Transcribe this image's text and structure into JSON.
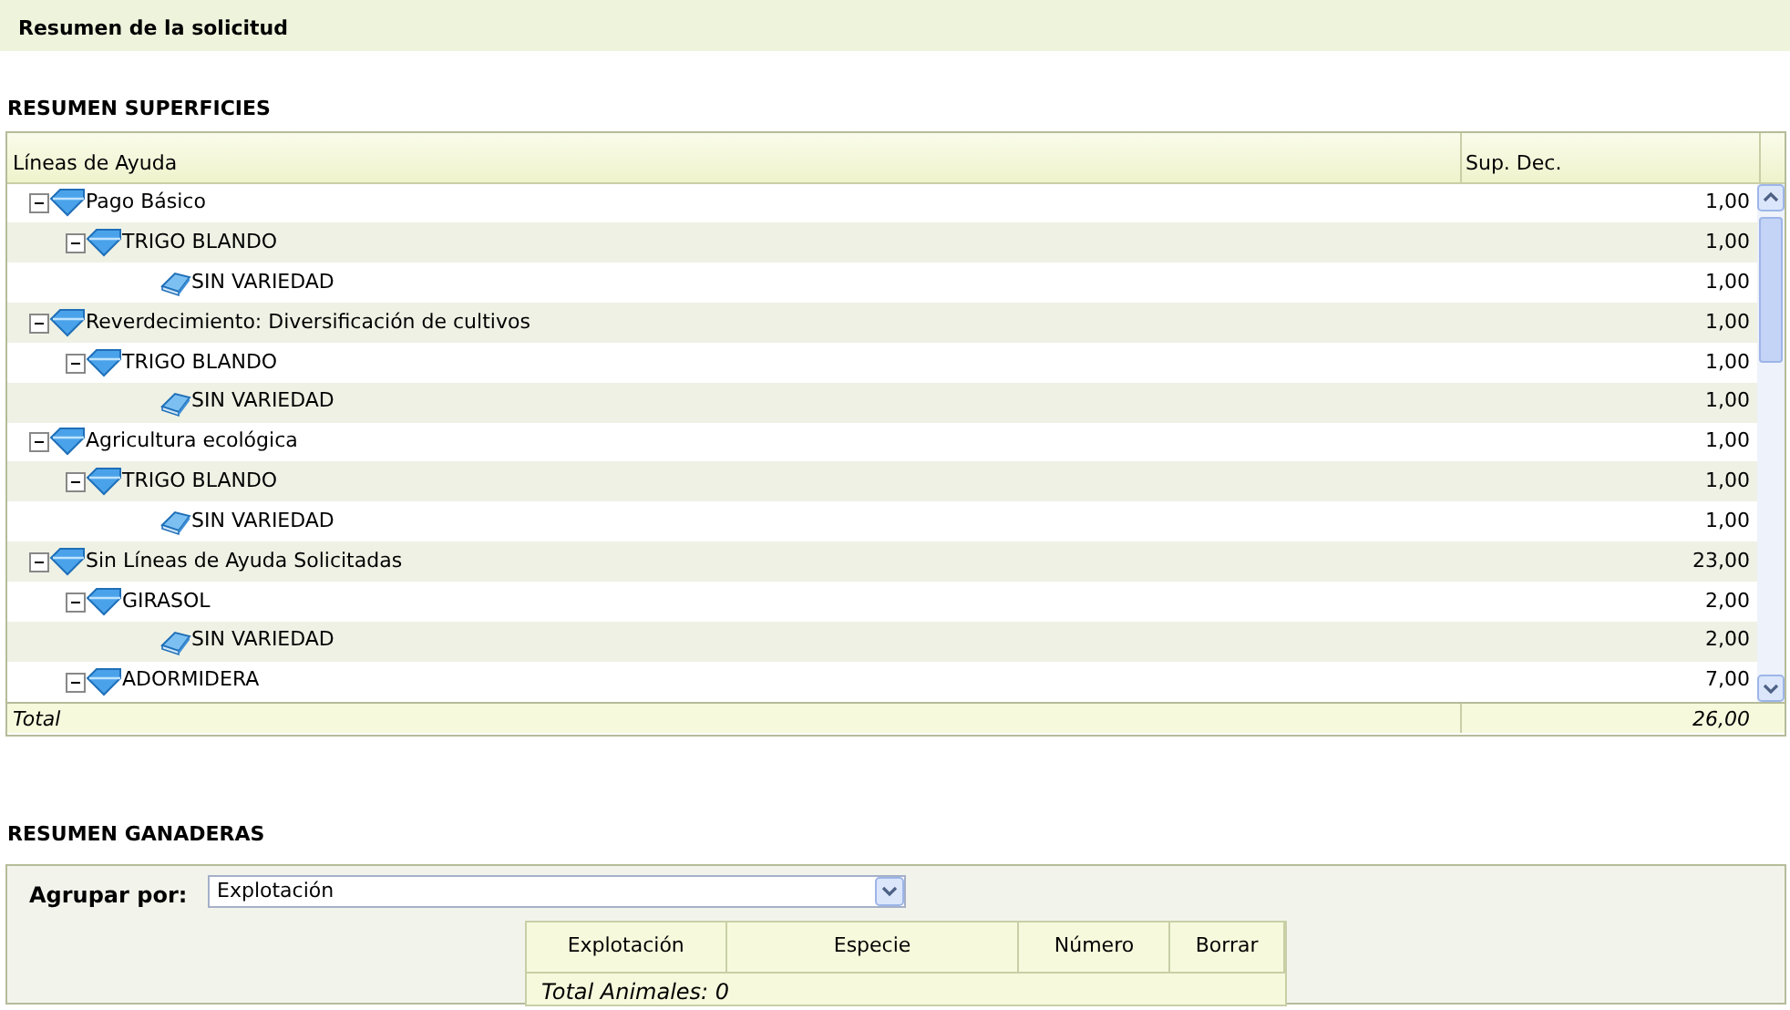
{
  "page_title": "Resumen de la solicitud",
  "superficies": {
    "heading": "RESUMEN SUPERFICIES",
    "columns": [
      "Líneas de Ayuda",
      "Sup. Dec."
    ],
    "tree": [
      {
        "label": "Pago Básico",
        "value": "1,00",
        "kind": "group",
        "expanded": true,
        "children": [
          {
            "label": "TRIGO BLANDO",
            "value": "1,00",
            "kind": "group",
            "expanded": true,
            "children": [
              {
                "label": "SIN VARIEDAD",
                "value": "1,00",
                "kind": "leaf"
              }
            ]
          }
        ]
      },
      {
        "label": "Reverdecimiento: Diversificación de cultivos",
        "value": "1,00",
        "kind": "group",
        "expanded": true,
        "children": [
          {
            "label": "TRIGO BLANDO",
            "value": "1,00",
            "kind": "group",
            "expanded": true,
            "children": [
              {
                "label": "SIN VARIEDAD",
                "value": "1,00",
                "kind": "leaf"
              }
            ]
          }
        ]
      },
      {
        "label": "Agricultura ecológica",
        "value": "1,00",
        "kind": "group",
        "expanded": true,
        "children": [
          {
            "label": "TRIGO BLANDO",
            "value": "1,00",
            "kind": "group",
            "expanded": true,
            "children": [
              {
                "label": "SIN VARIEDAD",
                "value": "1,00",
                "kind": "leaf"
              }
            ]
          }
        ]
      },
      {
        "label": "Sin Líneas de Ayuda Solicitadas",
        "value": "23,00",
        "kind": "group",
        "expanded": true,
        "children": [
          {
            "label": "GIRASOL",
            "value": "2,00",
            "kind": "group",
            "expanded": true,
            "children": [
              {
                "label": "SIN VARIEDAD",
                "value": "2,00",
                "kind": "leaf"
              }
            ]
          },
          {
            "label": "ADORMIDERA",
            "value": "7,00",
            "kind": "group",
            "expanded": true
          }
        ]
      }
    ],
    "total": {
      "label": "Total",
      "value": "26,00"
    }
  },
  "ganaderas": {
    "heading": "RESUMEN GANADERAS",
    "group_by": {
      "label": "Agrupar por:",
      "value": "Explotación"
    },
    "columns": [
      "Explotación",
      "Especie",
      "Número",
      "Borrar"
    ],
    "total": "Total Animales: 0"
  }
}
